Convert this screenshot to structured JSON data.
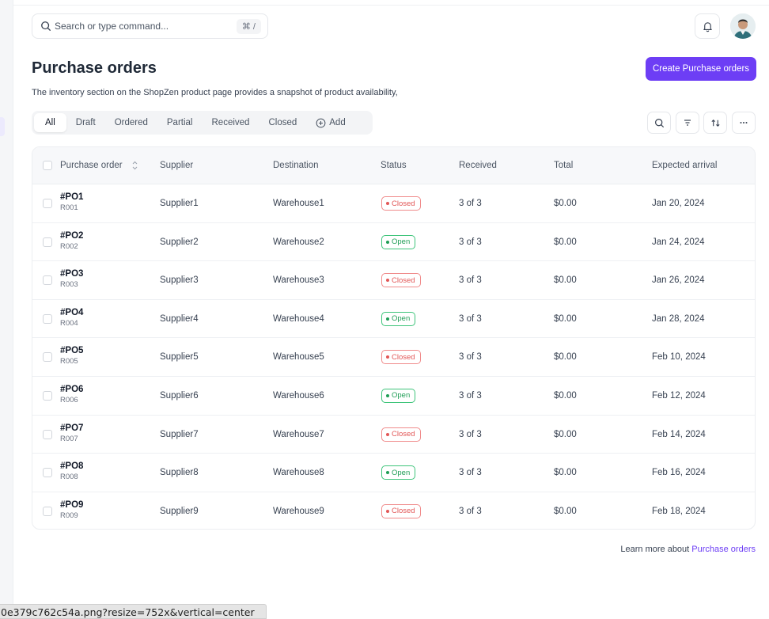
{
  "search": {
    "placeholder": "Search or type command...",
    "shortcut": "⌘ /"
  },
  "header": {
    "title": "Purchase orders",
    "description": "The inventory section on the ShopZen product page provides a snapshot of product availability,",
    "create_label": "Create Purchase orders"
  },
  "tabs": [
    {
      "label": "All",
      "active": true
    },
    {
      "label": "Draft"
    },
    {
      "label": "Ordered"
    },
    {
      "label": "Partial"
    },
    {
      "label": "Received"
    },
    {
      "label": "Closed"
    },
    {
      "label": "Add"
    }
  ],
  "table": {
    "columns": [
      "Purchase order",
      "Supplier",
      "Destination",
      "Status",
      "Received",
      "Total",
      "Expected arrival"
    ],
    "rows": [
      {
        "po": "#PO1",
        "ref": "R001",
        "supplier": "Supplier1",
        "destination": "Warehouse1",
        "status": "Closed",
        "received": "3 of 3",
        "total": "$0.00",
        "arrival": "Jan 20, 2024"
      },
      {
        "po": "#PO2",
        "ref": "R002",
        "supplier": "Supplier2",
        "destination": "Warehouse2",
        "status": "Open",
        "received": "3 of 3",
        "total": "$0.00",
        "arrival": "Jan 24, 2024"
      },
      {
        "po": "#PO3",
        "ref": "R003",
        "supplier": "Supplier3",
        "destination": "Warehouse3",
        "status": "Closed",
        "received": "3 of 3",
        "total": "$0.00",
        "arrival": "Jan 26, 2024"
      },
      {
        "po": "#PO4",
        "ref": "R004",
        "supplier": "Supplier4",
        "destination": "Warehouse4",
        "status": "Open",
        "received": "3 of 3",
        "total": "$0.00",
        "arrival": "Jan 28, 2024"
      },
      {
        "po": "#PO5",
        "ref": "R005",
        "supplier": "Supplier5",
        "destination": "Warehouse5",
        "status": "Closed",
        "received": "3 of 3",
        "total": "$0.00",
        "arrival": "Feb 10, 2024"
      },
      {
        "po": "#PO6",
        "ref": "R006",
        "supplier": "Supplier6",
        "destination": "Warehouse6",
        "status": "Open",
        "received": "3 of 3",
        "total": "$0.00",
        "arrival": "Feb 12, 2024"
      },
      {
        "po": "#PO7",
        "ref": "R007",
        "supplier": "Supplier7",
        "destination": "Warehouse7",
        "status": "Closed",
        "received": "3 of 3",
        "total": "$0.00",
        "arrival": "Feb 14, 2024"
      },
      {
        "po": "#PO8",
        "ref": "R008",
        "supplier": "Supplier8",
        "destination": "Warehouse8",
        "status": "Open",
        "received": "3 of 3",
        "total": "$0.00",
        "arrival": "Feb 16, 2024"
      },
      {
        "po": "#PO9",
        "ref": "R009",
        "supplier": "Supplier9",
        "destination": "Warehouse9",
        "status": "Closed",
        "received": "3 of 3",
        "total": "$0.00",
        "arrival": "Feb 18, 2024"
      }
    ]
  },
  "footer": {
    "prefix": "Learn more about ",
    "link": "Purchase orders"
  },
  "status_url": "0e379c762c54a.png?resize=752x&vertical=center",
  "colors": {
    "accent": "#6d3ef5",
    "closed": "#e25757",
    "open": "#1f9d55"
  },
  "icons": [
    "search-icon",
    "bell-icon",
    "avatar",
    "plus-circle-icon",
    "filter-icon",
    "sort-icon",
    "more-icon",
    "sort-chevrons-icon"
  ]
}
